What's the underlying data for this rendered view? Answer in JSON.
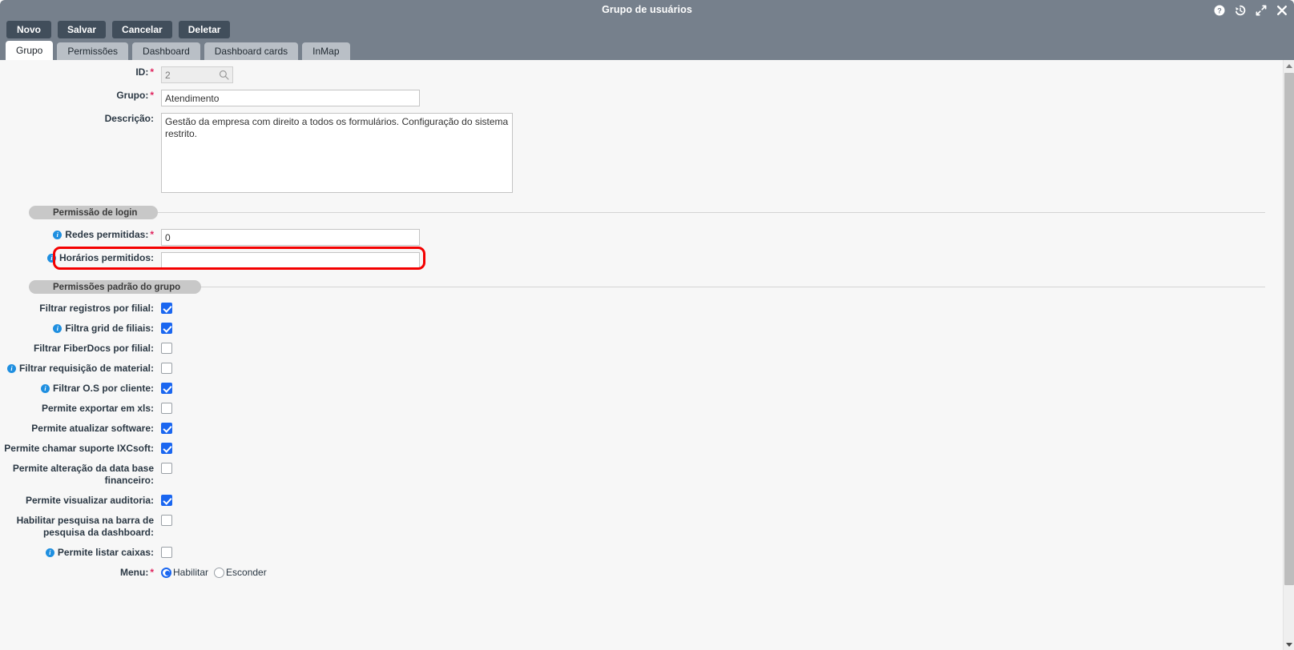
{
  "window": {
    "title": "Grupo de usuários",
    "icons": [
      {
        "name": "help-icon",
        "glyph": "?"
      },
      {
        "name": "history-icon",
        "glyph": "↺"
      },
      {
        "name": "expand-icon",
        "glyph": "⤢"
      },
      {
        "name": "close-icon",
        "glyph": "✕"
      }
    ]
  },
  "toolbar": {
    "new_label": "Novo",
    "save_label": "Salvar",
    "cancel_label": "Cancelar",
    "delete_label": "Deletar"
  },
  "tabs": [
    {
      "label": "Grupo",
      "active": true
    },
    {
      "label": "Permissões",
      "active": false
    },
    {
      "label": "Dashboard",
      "active": false
    },
    {
      "label": "Dashboard cards",
      "active": false
    },
    {
      "label": "InMap",
      "active": false
    }
  ],
  "form": {
    "id": {
      "label": "ID:",
      "required": true,
      "value": "2",
      "disabled": true,
      "search_icon": "search-icon"
    },
    "grupo": {
      "label": "Grupo:",
      "required": true,
      "value": "Atendimento"
    },
    "descricao": {
      "label": "Descrição:",
      "value": "Gestão da empresa com direito a todos os formulários. Configuração do sistema restrito."
    }
  },
  "sections": {
    "login": {
      "title": "Permissão de login"
    },
    "permissions": {
      "title": "Permissões padrão do grupo"
    }
  },
  "login_fields": [
    {
      "label": "Redes permitidas:",
      "required": true,
      "info": true,
      "value": "0",
      "highlighted": false
    },
    {
      "label": "Horários permitidos:",
      "required": false,
      "info": true,
      "value": "",
      "highlighted": true
    }
  ],
  "permission_checkboxes": [
    {
      "label": "Filtrar registros por filial:",
      "info": false,
      "checked": true
    },
    {
      "label": "Filtra grid de filiais:",
      "info": true,
      "checked": true
    },
    {
      "label": "Filtrar FiberDocs por filial:",
      "info": false,
      "checked": false
    },
    {
      "label": "Filtrar requisição de material:",
      "info": true,
      "checked": false
    },
    {
      "label": "Filtrar O.S por cliente:",
      "info": true,
      "checked": true
    },
    {
      "label": "Permite exportar em xls:",
      "info": false,
      "checked": false
    },
    {
      "label": "Permite atualizar software:",
      "info": false,
      "checked": true
    },
    {
      "label": "Permite chamar suporte IXCsoft:",
      "info": false,
      "checked": true
    },
    {
      "label": "Permite alteração da data base financeiro:",
      "info": false,
      "checked": false
    },
    {
      "label": "Permite visualizar auditoria:",
      "info": false,
      "checked": true
    },
    {
      "label": "Habilitar pesquisa na barra de pesquisa da dashboard:",
      "info": false,
      "checked": false
    },
    {
      "label": "Permite listar caixas:",
      "info": true,
      "checked": false
    }
  ],
  "menu_field": {
    "label": "Menu:",
    "required": true,
    "options": [
      {
        "label": "Habilitar",
        "selected": true
      },
      {
        "label": "Esconder",
        "selected": false
      }
    ]
  },
  "colors": {
    "titlebar": "#76808c",
    "button": "#414e5b",
    "tab_inactive": "#b9bfc6",
    "tab_active": "#ffffff",
    "accent_checkbox": "#1a66f0",
    "info_icon": "#1f8fe0",
    "required_star": "#e0245e",
    "highlight_ring": "#f40000",
    "page_background": "#f7f7f7"
  }
}
